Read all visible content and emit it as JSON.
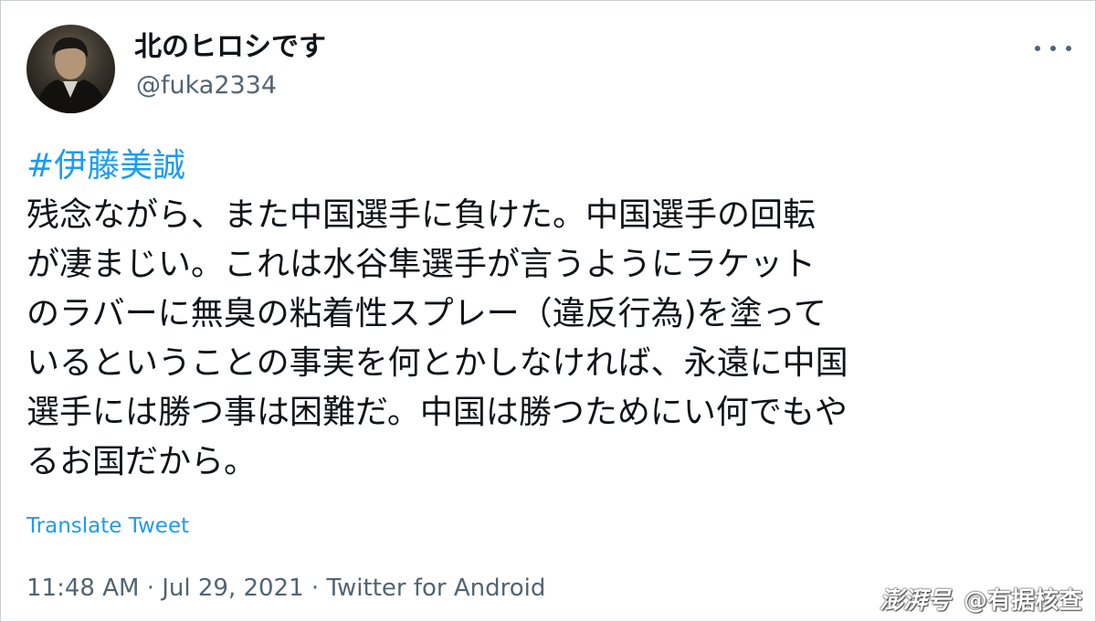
{
  "tweet": {
    "display_name": "北のヒロシです",
    "handle": "@fuka2334",
    "hashtag": "#伊藤美誠",
    "body_lines": [
      "残念ながら、また中国選手に負けた。中国選手の回転",
      "が凄まじい。これは水谷隼選手が言うようにラケット",
      "のラバーに無臭の粘着性スプレー（違反行為)を塗って",
      "いるということの事実を何とかしなければ、永遠に中国",
      "選手には勝つ事は困難だ。中国は勝つためにい何でもや",
      "るお国だから。"
    ],
    "translate_label": "Translate Tweet",
    "time": "11:48 AM",
    "date": "Jul 29, 2021",
    "source": "Twitter for Android",
    "separator": "·"
  },
  "icons": {
    "more": "more-dots-icon",
    "avatar": "profile-avatar"
  },
  "watermark": {
    "brand": "澎湃号",
    "account": "@有据核查"
  },
  "colors": {
    "link": "#1d9bf0",
    "secondary_text": "#536471",
    "primary_text": "#0f1419"
  }
}
